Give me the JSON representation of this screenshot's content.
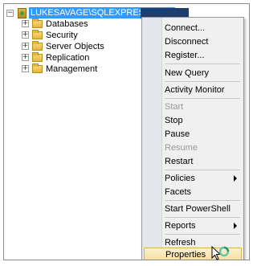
{
  "tree": {
    "server": {
      "label": "LUKESAVAGE\\SQLEXPRESS (SQL"
    },
    "nodes": [
      {
        "label": "Databases"
      },
      {
        "label": "Security"
      },
      {
        "label": "Server Objects"
      },
      {
        "label": "Replication"
      },
      {
        "label": "Management"
      }
    ]
  },
  "context_menu": {
    "items": [
      {
        "label": "Connect..."
      },
      {
        "label": "Disconnect"
      },
      {
        "label": "Register..."
      },
      {
        "label": "New Query"
      },
      {
        "label": "Activity Monitor"
      },
      {
        "label": "Start",
        "disabled": true
      },
      {
        "label": "Stop"
      },
      {
        "label": "Pause"
      },
      {
        "label": "Resume",
        "disabled": true
      },
      {
        "label": "Restart"
      },
      {
        "label": "Policies",
        "submenu": true
      },
      {
        "label": "Facets"
      },
      {
        "label": "Start PowerShell"
      },
      {
        "label": "Reports",
        "submenu": true
      },
      {
        "label": "Refresh"
      },
      {
        "label": "Properties",
        "hovered": true
      }
    ]
  },
  "colors": {
    "selection": "#3399ff",
    "menu_background": "#f0f0f0",
    "hover_highlight": "#f5dfa1"
  }
}
